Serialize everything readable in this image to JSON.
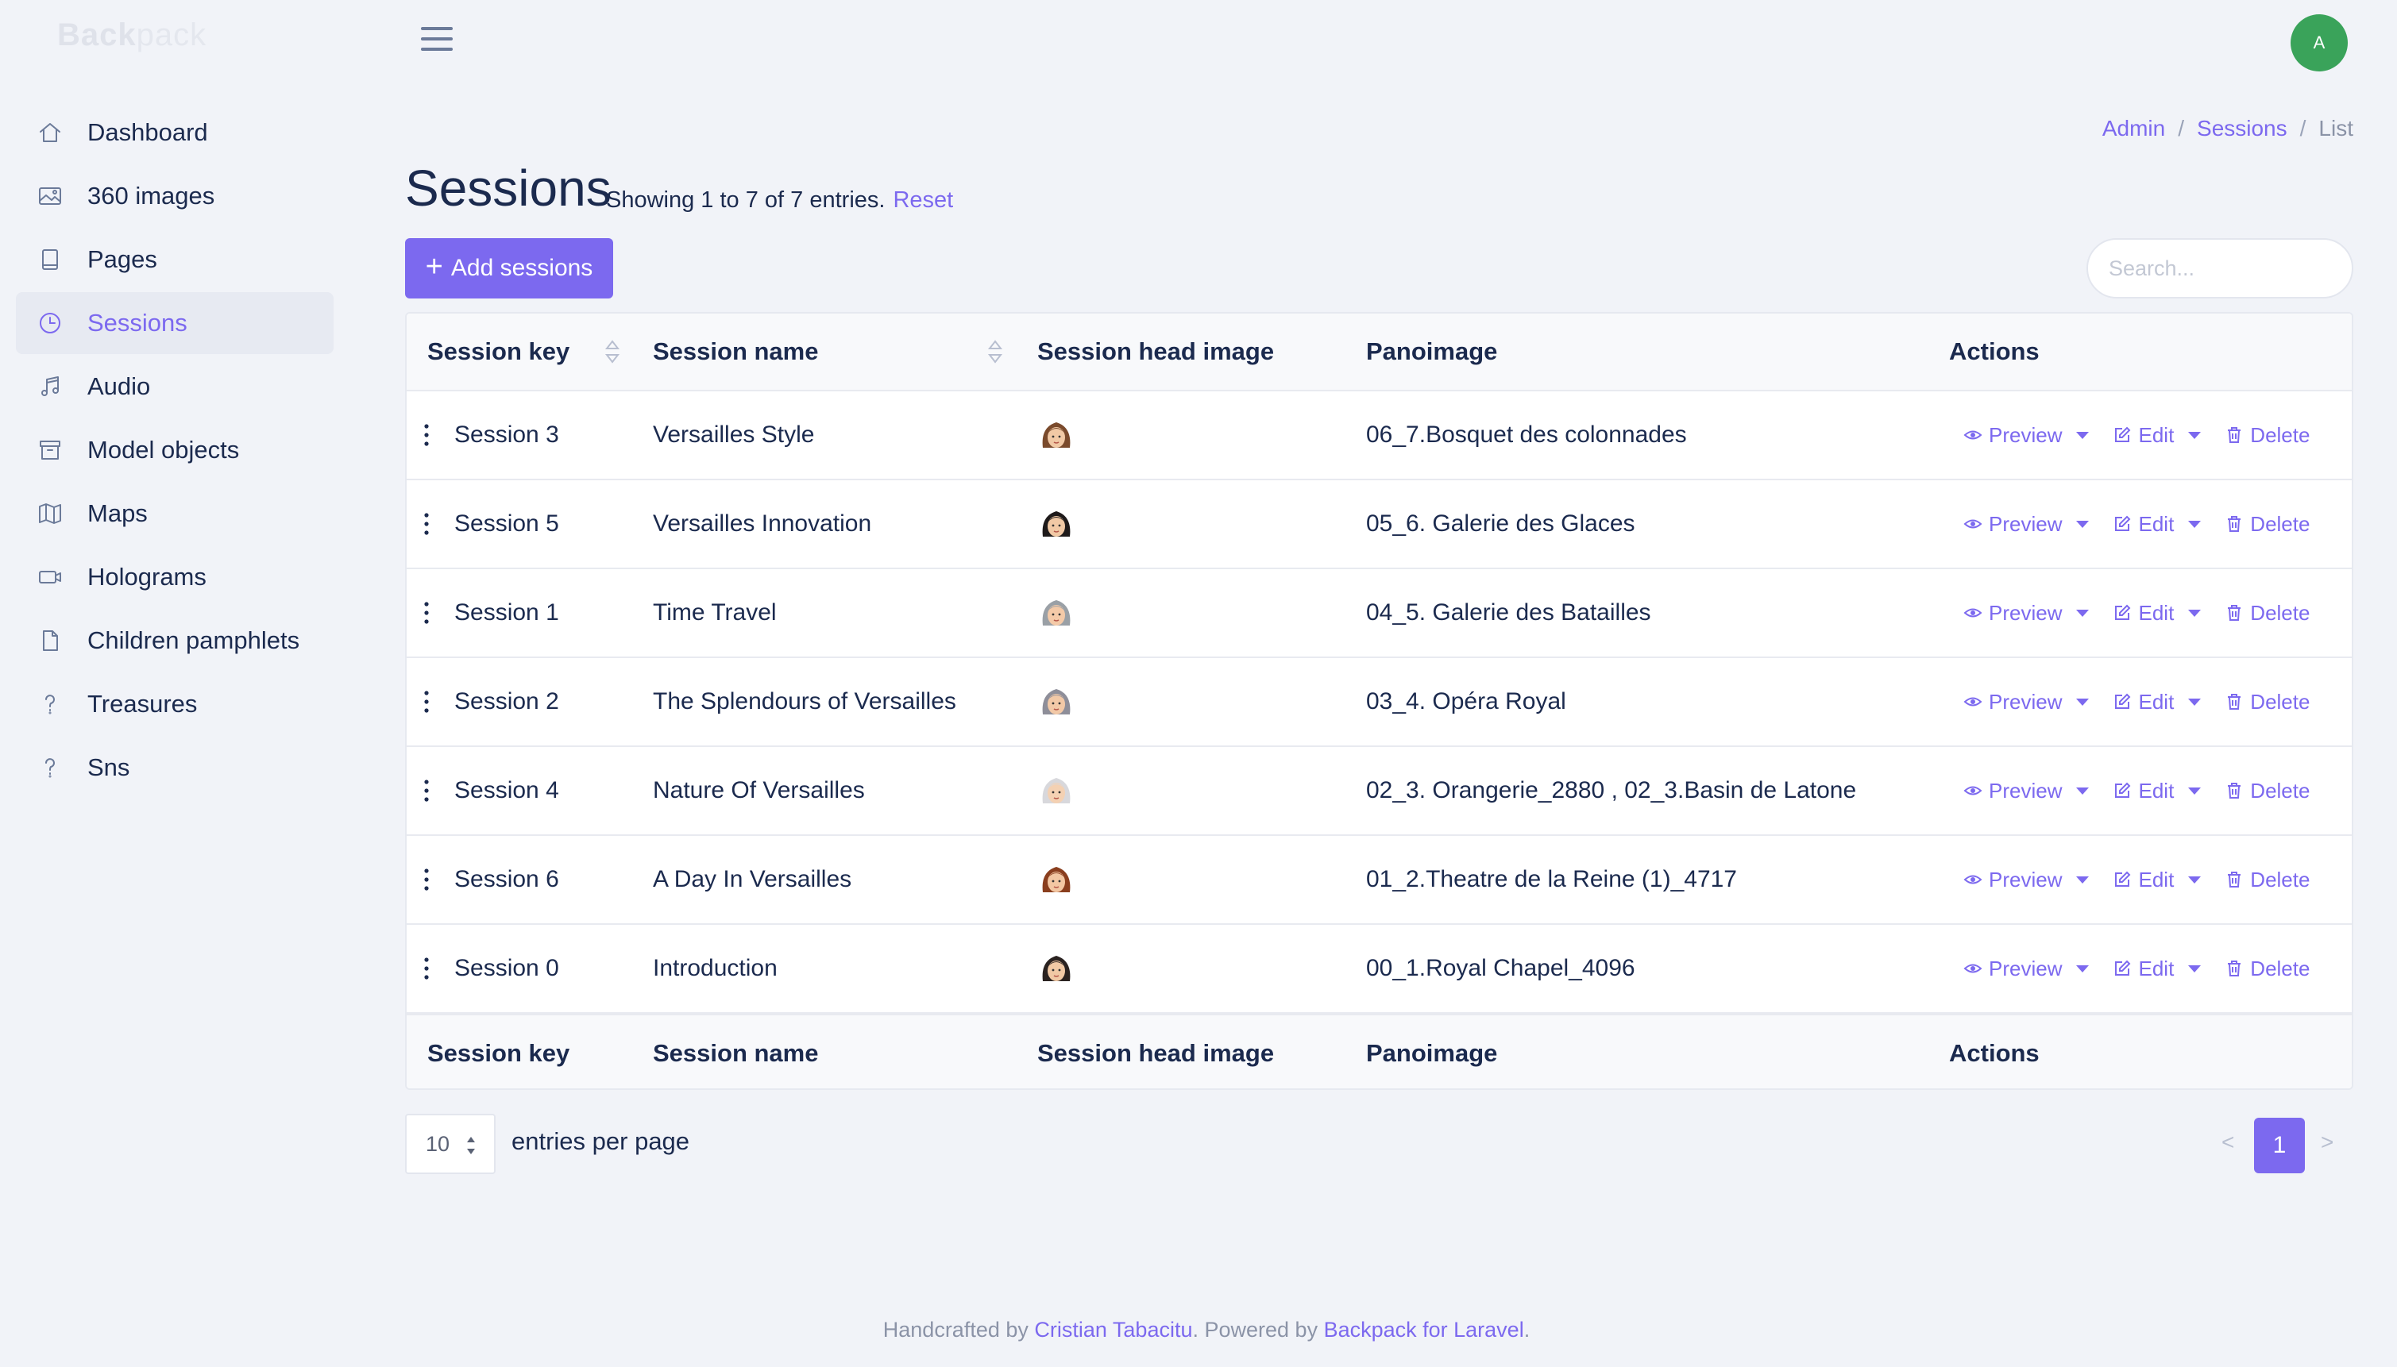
{
  "brand": {
    "bold": "Back",
    "light": "pack"
  },
  "user": {
    "initial": "A"
  },
  "sidebar": {
    "items": [
      {
        "label": "Dashboard",
        "icon": "home-icon"
      },
      {
        "label": "360 images",
        "icon": "image-icon"
      },
      {
        "label": "Pages",
        "icon": "page-icon"
      },
      {
        "label": "Sessions",
        "icon": "clock-icon",
        "active": true
      },
      {
        "label": "Audio",
        "icon": "music-icon"
      },
      {
        "label": "Model objects",
        "icon": "archive-icon"
      },
      {
        "label": "Maps",
        "icon": "map-icon"
      },
      {
        "label": "Holograms",
        "icon": "video-icon"
      },
      {
        "label": "Children pamphlets",
        "icon": "file-icon"
      },
      {
        "label": "Treasures",
        "icon": "question-icon"
      },
      {
        "label": "Sns",
        "icon": "question-icon"
      }
    ]
  },
  "breadcrumb": {
    "items": [
      "Admin",
      "Sessions"
    ],
    "current": "List",
    "separator": "/"
  },
  "header": {
    "title": "Sessions",
    "entries_info": "Showing 1 to 7 of 7 entries.",
    "reset_label": "Reset",
    "add_button_label": "Add sessions"
  },
  "search": {
    "placeholder": "Search..."
  },
  "table": {
    "columns": [
      "Session key",
      "Session name",
      "Session head image",
      "Panoimage",
      "Actions"
    ],
    "action_labels": {
      "preview": "Preview",
      "edit": "Edit",
      "delete": "Delete"
    },
    "rows": [
      {
        "key": "Session 3",
        "name": "Versailles Style",
        "panoimage": "06_7.Bosquet des colonnades",
        "hair": "#7a4a2c",
        "skin": "#f1c9a5"
      },
      {
        "key": "Session 5",
        "name": "Versailles Innovation",
        "panoimage": "05_6. Galerie des Glaces",
        "hair": "#1e1a1a",
        "skin": "#f1c9a5"
      },
      {
        "key": "Session 1",
        "name": "Time Travel",
        "panoimage": "04_5. Galerie des Batailles",
        "hair": "#9aa0a6",
        "skin": "#f4caa8"
      },
      {
        "key": "Session 2",
        "name": "The Splendours of Versailles",
        "panoimage": "03_4. Opéra Royal",
        "hair": "#8e8e99",
        "skin": "#f2c9a7"
      },
      {
        "key": "Session 4",
        "name": "Nature Of Versailles",
        "panoimage": "02_3. Orangerie_2880 , 02_3.Basin de Latone",
        "hair": "#d8d8dc",
        "skin": "#f4d1b3"
      },
      {
        "key": "Session 6",
        "name": "A Day In Versailles",
        "panoimage": "01_2.Theatre de la Reine (1)_4717",
        "hair": "#8a3e1e",
        "skin": "#f3c7a3"
      },
      {
        "key": "Session 0",
        "name": "Introduction",
        "panoimage": "00_1.Royal Chapel_4096",
        "hair": "#2a2220",
        "skin": "#f1c9a5"
      }
    ]
  },
  "pagination": {
    "per_page": "10",
    "per_page_label": "entries per page",
    "current_page": "1",
    "prev": "<",
    "next": ">"
  },
  "footer": {
    "prefix": "Handcrafted by ",
    "author": "Cristian Tabacitu",
    "middle": ". Powered by ",
    "powered": "Backpack for Laravel",
    "suffix": "."
  },
  "colors": {
    "accent": "#7c69ef",
    "avatar": "#3aa35a",
    "background": "#f1f3f8",
    "text": "#1b2a4e"
  }
}
